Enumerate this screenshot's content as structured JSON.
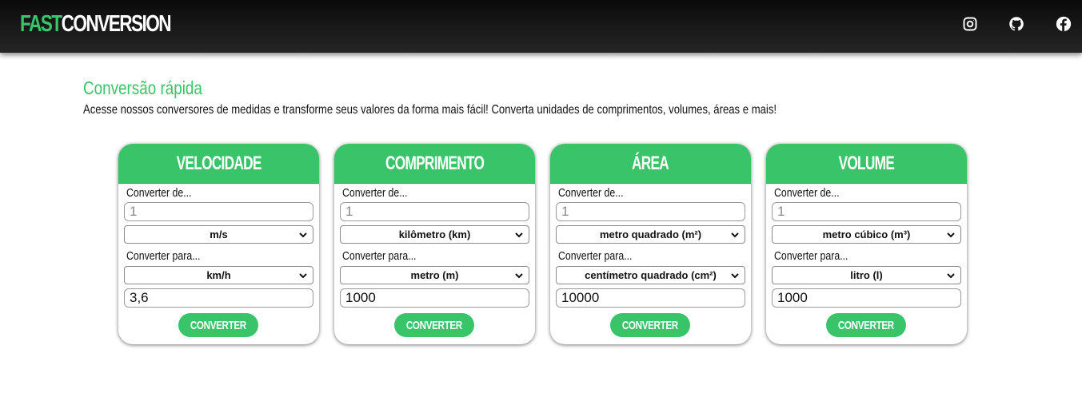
{
  "header": {
    "logo_part1": "FAST",
    "logo_part2": "CONVERSION",
    "social_icons": [
      "instagram-icon",
      "github-icon",
      "facebook-icon"
    ]
  },
  "intro": {
    "title": "Conversão rápida",
    "description": "Acesse nossos conversores de medidas e transforme seus valores da forma mais fácil! Converta unidades de comprimentos, volumes, áreas e mais!"
  },
  "colors": {
    "accent": "#39c46a",
    "header_bg": "#1a1a1a"
  },
  "cards": [
    {
      "title": "VELOCIDADE",
      "from_label": "Converter de...",
      "input_placeholder": "1",
      "from_unit": "m/s",
      "to_label": "Converter para...",
      "to_unit": "km/h",
      "result": "3,6",
      "button": "CONVERTER"
    },
    {
      "title": "COMPRIMENTO",
      "from_label": "Converter de...",
      "input_placeholder": "1",
      "from_unit": "kilômetro (km)",
      "to_label": "Converter para...",
      "to_unit": "metro (m)",
      "result": "1000",
      "button": "CONVERTER"
    },
    {
      "title": "ÁREA",
      "from_label": "Converter de...",
      "input_placeholder": "1",
      "from_unit": "metro quadrado (m²)",
      "to_label": "Converter para...",
      "to_unit": "centímetro quadrado (cm²)",
      "result": "10000",
      "button": "CONVERTER"
    },
    {
      "title": "VOLUME",
      "from_label": "Converter de...",
      "input_placeholder": "1",
      "from_unit": "metro cúbico (m³)",
      "to_label": "Converter para...",
      "to_unit": "litro (l)",
      "result": "1000",
      "button": "CONVERTER"
    }
  ]
}
